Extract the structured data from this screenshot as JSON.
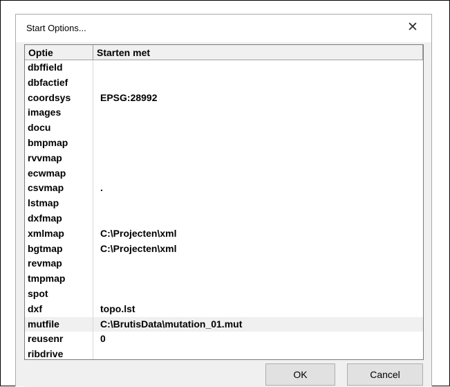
{
  "dialog": {
    "title": "Start Options...",
    "close_glyph": "✕"
  },
  "grid": {
    "columns": [
      "Optie",
      "Starten met"
    ],
    "rows": [
      {
        "option": "dbffield",
        "value": ""
      },
      {
        "option": "dbfactief",
        "value": ""
      },
      {
        "option": "coordsys",
        "value": "EPSG:28992"
      },
      {
        "option": "images",
        "value": ""
      },
      {
        "option": "docu",
        "value": ""
      },
      {
        "option": "bmpmap",
        "value": ""
      },
      {
        "option": "rvvmap",
        "value": ""
      },
      {
        "option": "ecwmap",
        "value": ""
      },
      {
        "option": "csvmap",
        "value": "."
      },
      {
        "option": "lstmap",
        "value": ""
      },
      {
        "option": "dxfmap",
        "value": ""
      },
      {
        "option": "xmlmap",
        "value": "C:\\Projecten\\xml"
      },
      {
        "option": "bgtmap",
        "value": "C:\\Projecten\\xml"
      },
      {
        "option": "revmap",
        "value": ""
      },
      {
        "option": "tmpmap",
        "value": ""
      },
      {
        "option": "spot",
        "value": ""
      },
      {
        "option": "dxf",
        "value": "topo.lst"
      },
      {
        "option": "mutfile",
        "value": "C:\\BrutisData\\mutation_01.mut"
      },
      {
        "option": "reusenr",
        "value": "0"
      },
      {
        "option": "ribdrive",
        "value": ""
      }
    ],
    "selected_row": 17
  },
  "buttons": {
    "ok": "OK",
    "cancel": "Cancel"
  }
}
